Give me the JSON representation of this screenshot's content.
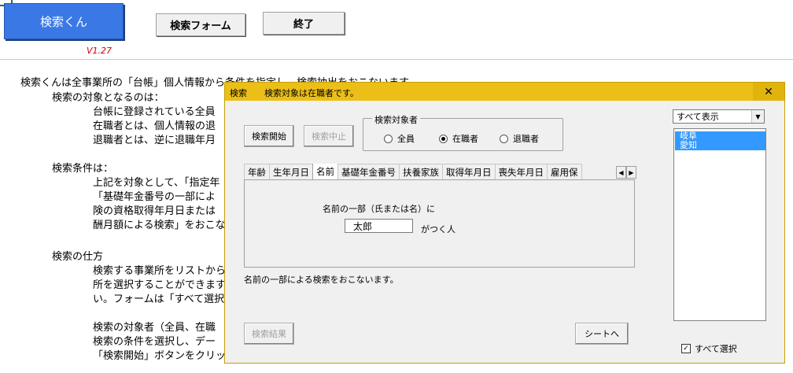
{
  "sheet": {
    "app_button": "検索くん",
    "version": "V1.27",
    "form_button": "検索フォーム",
    "exit_button": "終了",
    "lines": [
      "検索くんは全事業所の「台帳」個人情報から条件を指定し、検索抽出をおこないます。",
      "検索の対象となるのは：",
      "台帳に登録されている全員",
      "在職者とは、個人情報の退",
      "退職者とは、逆に退職年月",
      "検索条件は：",
      "上記を対象として、「指定年",
      "「基礎年金番号の一部によ",
      "険の資格取得年月日または",
      "酬月額による検索」をおこな",
      "検索の仕方",
      "検索する事業所をリストから",
      "所を選択することができます",
      "い。フォームは「すべて選択",
      "検索の対象者（全員、在職",
      "検索の条件を選択し、デー",
      "「検索開始」ボタンをクリック"
    ]
  },
  "dialog": {
    "title": "検索　　検索対象は在職者です。",
    "close": "✕",
    "start_button": "検索開始",
    "stop_button": "検索中止",
    "group_label": "検索対象者",
    "radios": [
      {
        "label": "全員",
        "selected": false
      },
      {
        "label": "在職者",
        "selected": true
      },
      {
        "label": "退職者",
        "selected": false
      }
    ],
    "tabs": [
      "年齢",
      "生年月日",
      "名前",
      "基礎年金番号",
      "扶養家族",
      "取得年月日",
      "喪失年月日",
      "雇用保"
    ],
    "active_tab": "名前",
    "name_prompt": "名前の一部（氏または名）に",
    "name_value": "太郎",
    "name_suffix": "がつく人",
    "description": "名前の一部による検索をおこないます。",
    "results_button": "検索結果",
    "sheet_button": "シートへ",
    "combo_value": "すべて表示",
    "list_items": [
      "岐阜",
      "愛知"
    ],
    "select_all_label": "すべて選択",
    "select_all_checked": true
  }
}
